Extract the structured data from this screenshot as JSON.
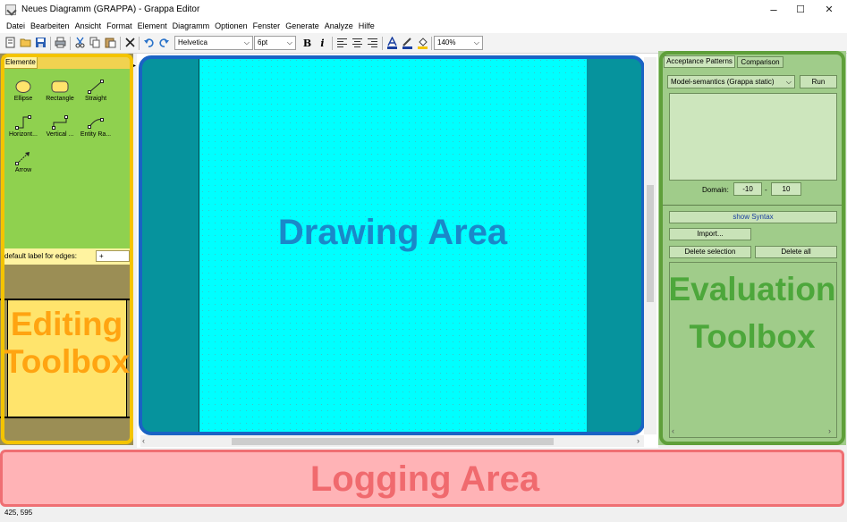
{
  "window": {
    "title": "Neues Diagramm (GRAPPA) - Grappa Editor",
    "minimize": "–",
    "maximize": "☐",
    "close": "✕"
  },
  "menu": [
    "Datei",
    "Bearbeiten",
    "Ansicht",
    "Format",
    "Element",
    "Diagramm",
    "Optionen",
    "Fenster",
    "Generate",
    "Analyze",
    "Hilfe"
  ],
  "toolbar": {
    "font": "Helvetica",
    "size": "6pt",
    "zoom": "140%",
    "bold": "B",
    "italic": "i"
  },
  "left": {
    "tab": "Elemente",
    "elements": [
      "Ellipse",
      "Rectangle",
      "Straight",
      "Horizont...",
      "Vertical ...",
      "Entity Ra...",
      "Arrow"
    ],
    "edge_label": "default label for edges:",
    "edge_value": "+",
    "overlay": "Editing Toolbox"
  },
  "drawing": {
    "overlay": "Drawing Area"
  },
  "right": {
    "tabs": [
      "Acceptance Patterns",
      "Comparison"
    ],
    "semantics": "Model-semantics (Grappa static)",
    "run": "Run",
    "domain_label": "Domain:",
    "domain_min": "-10",
    "domain_dash": "-",
    "domain_max": "10",
    "show_syntax": "show Syntax",
    "import": "Import...",
    "delete_selection": "Delete selection",
    "delete_all": "Delete all",
    "overlay": "Evaluation Toolbox"
  },
  "logging": {
    "overlay": "Logging Area"
  },
  "status": "425, 595",
  "colors": {
    "editing": "#f4c400",
    "drawing": "#1a63c4",
    "evaluation": "#5f9f3a",
    "logging": "#ef6f73"
  }
}
